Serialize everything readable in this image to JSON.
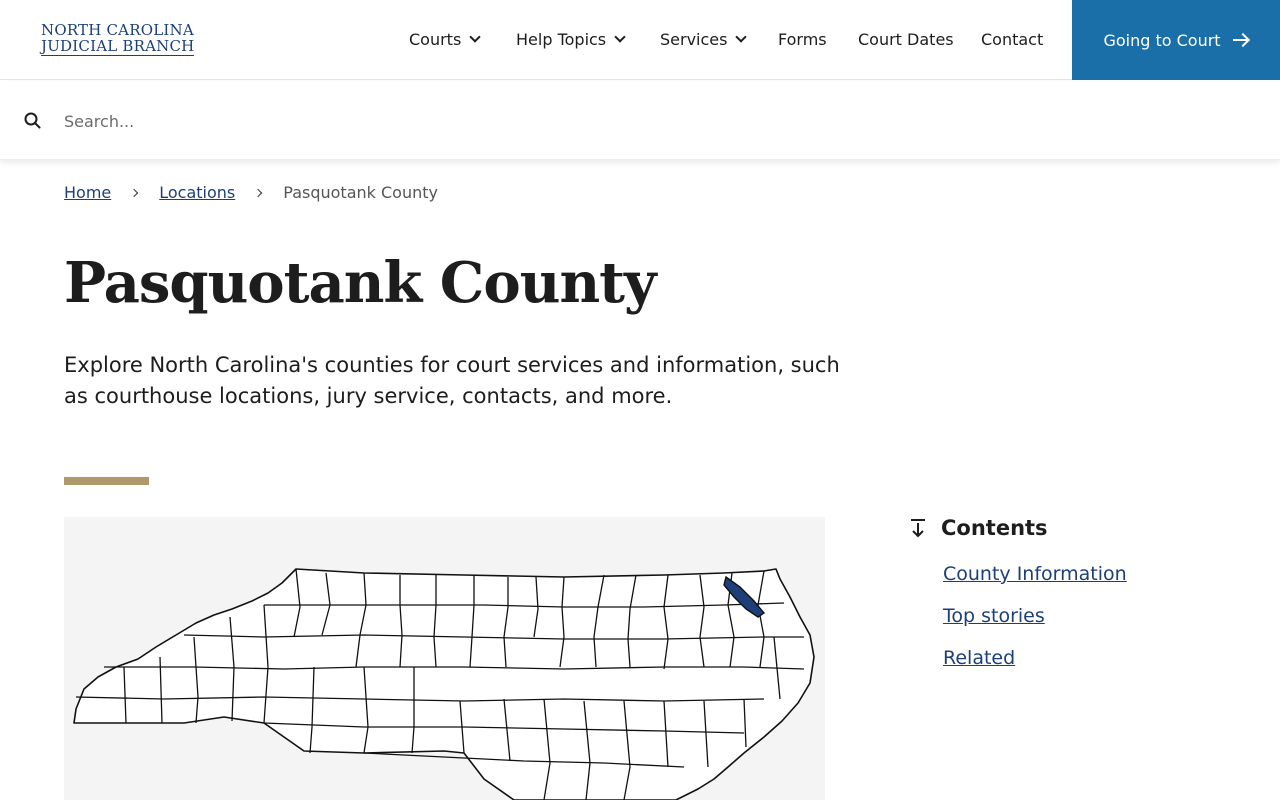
{
  "header": {
    "logo_line1": "NORTH CAROLINA",
    "logo_line2": "JUDICIAL BRANCH",
    "nav": [
      {
        "label": "Courts",
        "has_dropdown": true
      },
      {
        "label": "Help Topics",
        "has_dropdown": true
      },
      {
        "label": "Services",
        "has_dropdown": true
      },
      {
        "label": "Forms",
        "has_dropdown": false
      },
      {
        "label": "Court Dates",
        "has_dropdown": false
      },
      {
        "label": "Contact",
        "has_dropdown": false
      }
    ],
    "cta_label": "Going to Court",
    "cta_color": "#1a6fa8"
  },
  "search": {
    "placeholder": "Search...",
    "value": ""
  },
  "breadcrumb": {
    "home": "Home",
    "locations": "Locations",
    "current": "Pasquotank County"
  },
  "page": {
    "title": "Pasquotank County",
    "lead": "Explore North Carolina's counties for court services and information, such as courthouse locations, jury service, contacts, and more.",
    "accent_color": "#b0986d"
  },
  "map": {
    "highlight_color": "#1c3f7a"
  },
  "contents": {
    "title": "Contents",
    "links": [
      "County Information",
      "Top stories",
      "Related"
    ]
  }
}
